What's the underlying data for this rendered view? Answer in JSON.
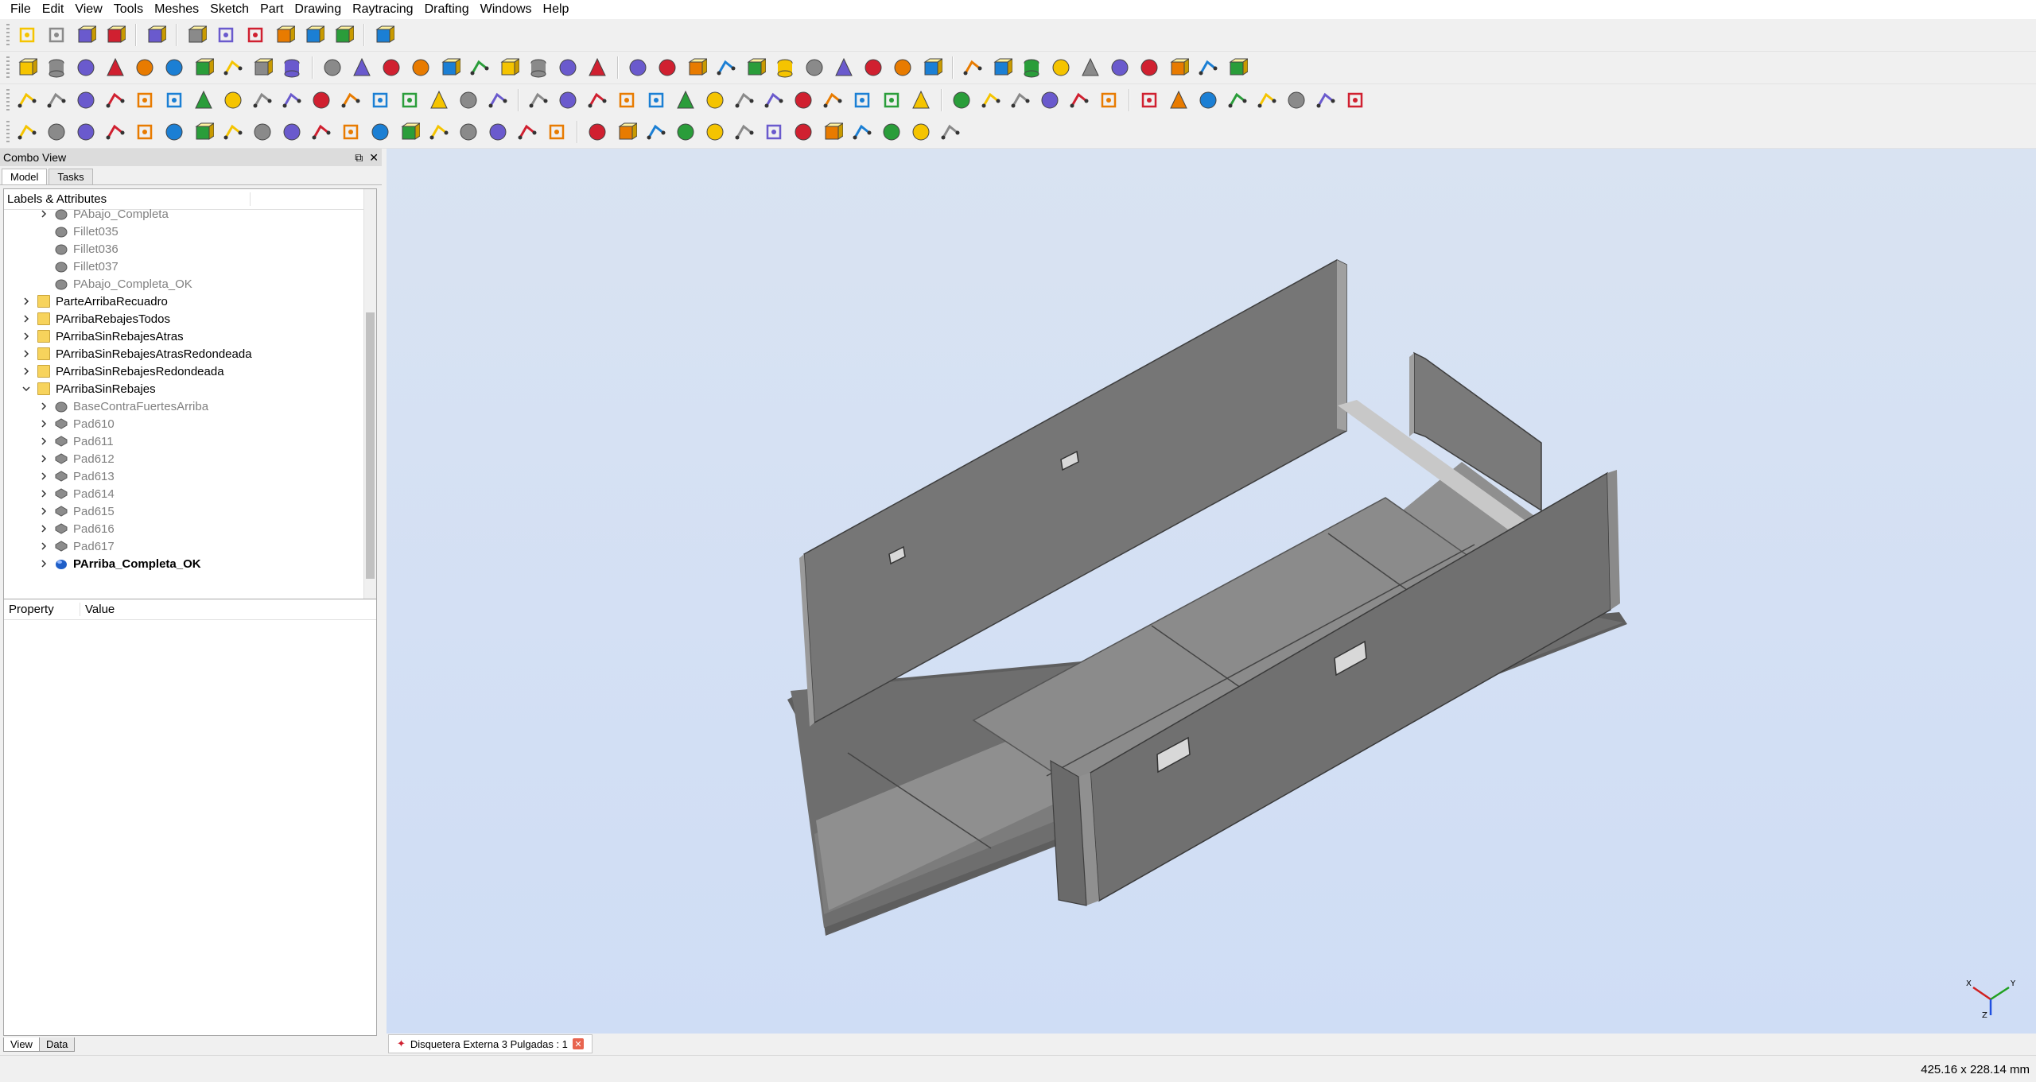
{
  "menu": [
    "File",
    "Edit",
    "View",
    "Tools",
    "Meshes",
    "Sketch",
    "Part",
    "Drawing",
    "Raytracing",
    "Drafting",
    "Windows",
    "Help"
  ],
  "combo": {
    "title": "Combo View",
    "tabs": [
      "Model",
      "Tasks"
    ],
    "tree_header": "Labels & Attributes",
    "tree_items": [
      {
        "label": "PAbajo_Completa",
        "indent": 2,
        "arrow": "right",
        "icon": "solid",
        "style": "gray"
      },
      {
        "label": "Fillet035",
        "indent": 2,
        "arrow": "none",
        "icon": "solid",
        "style": "gray"
      },
      {
        "label": "Fillet036",
        "indent": 2,
        "arrow": "none",
        "icon": "solid",
        "style": "gray"
      },
      {
        "label": "Fillet037",
        "indent": 2,
        "arrow": "none",
        "icon": "solid",
        "style": "gray"
      },
      {
        "label": "PAbajo_Completa_OK",
        "indent": 2,
        "arrow": "none",
        "icon": "solid",
        "style": "gray"
      },
      {
        "label": "ParteArribaRecuadro",
        "indent": 1,
        "arrow": "right",
        "icon": "folder",
        "style": "normal"
      },
      {
        "label": "PArribaRebajesTodos",
        "indent": 1,
        "arrow": "right",
        "icon": "folder",
        "style": "normal"
      },
      {
        "label": "PArribaSinRebajesAtras",
        "indent": 1,
        "arrow": "right",
        "icon": "folder",
        "style": "normal"
      },
      {
        "label": "PArribaSinRebajesAtrasRedondeada",
        "indent": 1,
        "arrow": "right",
        "icon": "folder",
        "style": "normal"
      },
      {
        "label": "PArribaSinRebajesRedondeada",
        "indent": 1,
        "arrow": "right",
        "icon": "folder",
        "style": "normal"
      },
      {
        "label": "PArribaSinRebajes",
        "indent": 1,
        "arrow": "down",
        "icon": "folder",
        "style": "normal"
      },
      {
        "label": "BaseContraFuertesArriba",
        "indent": 2,
        "arrow": "right",
        "icon": "solid",
        "style": "gray"
      },
      {
        "label": "Pad610",
        "indent": 2,
        "arrow": "right",
        "icon": "pad",
        "style": "gray"
      },
      {
        "label": "Pad611",
        "indent": 2,
        "arrow": "right",
        "icon": "pad",
        "style": "gray"
      },
      {
        "label": "Pad612",
        "indent": 2,
        "arrow": "right",
        "icon": "pad",
        "style": "gray"
      },
      {
        "label": "Pad613",
        "indent": 2,
        "arrow": "right",
        "icon": "pad",
        "style": "gray"
      },
      {
        "label": "Pad614",
        "indent": 2,
        "arrow": "right",
        "icon": "pad",
        "style": "gray"
      },
      {
        "label": "Pad615",
        "indent": 2,
        "arrow": "right",
        "icon": "pad",
        "style": "gray"
      },
      {
        "label": "Pad616",
        "indent": 2,
        "arrow": "right",
        "icon": "pad",
        "style": "gray"
      },
      {
        "label": "Pad617",
        "indent": 2,
        "arrow": "right",
        "icon": "pad",
        "style": "gray"
      },
      {
        "label": "PArriba_Completa_OK",
        "indent": 2,
        "arrow": "right",
        "icon": "blue-solid",
        "style": "bold"
      }
    ],
    "prop_columns": [
      "Property",
      "Value"
    ],
    "bottom_tabs": [
      "View",
      "Data"
    ]
  },
  "document_tab": "Disquetera Externa 3 Pulgadas : 1",
  "status_dims": "425.16 x 228.14 mm",
  "axis_labels": {
    "x": "X",
    "y": "Y",
    "z": "Z"
  },
  "colors": {
    "viewport_top": "#d9e3f2",
    "model_gray": "#8a8a8a",
    "accent_blue": "#1b7fd4",
    "accent_yellow": "#f5c400",
    "accent_red": "#d02030"
  }
}
